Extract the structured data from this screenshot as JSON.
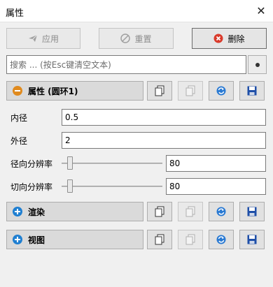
{
  "window": {
    "title": "属性",
    "close_glyph": "✕"
  },
  "toolbar": {
    "apply_label": "应用",
    "reset_label": "重置",
    "delete_label": "删除"
  },
  "search": {
    "placeholder": "搜索 ... (按Esc键清空文本)"
  },
  "sections": [
    {
      "label": "属性 (圆环1)",
      "expanded": true
    },
    {
      "label": "渲染",
      "expanded": false
    },
    {
      "label": "视图",
      "expanded": false
    }
  ],
  "properties": {
    "inner_radius": {
      "label": "内径",
      "value": "0.5"
    },
    "outer_radius": {
      "label": "外径",
      "value": "2"
    },
    "radial_resolution": {
      "label": "径向分辨率",
      "value": "80"
    },
    "tangential_resolution": {
      "label": "切向分辨率",
      "value": "80"
    }
  },
  "colors": {
    "delete_icon": "#d93a2b",
    "expanded_icon": "#e08a1e",
    "collapsed_icon": "#1f7fd1",
    "save_icon": "#1f4fa8",
    "reload_icon": "#2a7ad3"
  }
}
